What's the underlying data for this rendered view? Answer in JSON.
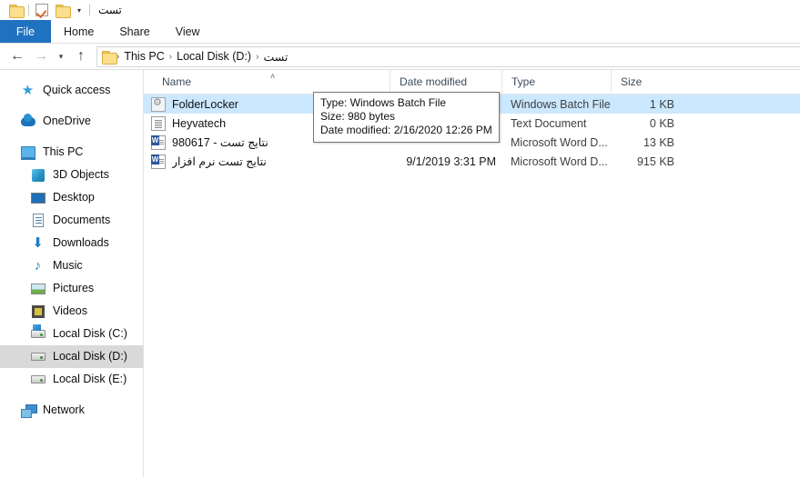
{
  "titlebar": {
    "quick_access": [
      {
        "name": "folder-icon",
        "label": ""
      },
      {
        "name": "properties-icon",
        "label": ""
      },
      {
        "name": "new-folder-icon",
        "label": ""
      }
    ],
    "dropdown_glyph": "▾",
    "window_title": "تست"
  },
  "ribbon": {
    "tabs": [
      {
        "label": "File",
        "active": true
      },
      {
        "label": "Home",
        "active": false
      },
      {
        "label": "Share",
        "active": false
      },
      {
        "label": "View",
        "active": false
      }
    ]
  },
  "navbar": {
    "back_glyph": "←",
    "forward_glyph": "→",
    "recent_glyph": "▾",
    "up_glyph": "↑",
    "separator": "›",
    "breadcrumbs": [
      {
        "label": "This PC",
        "rtl": false
      },
      {
        "label": "Local Disk (D:)",
        "rtl": false
      },
      {
        "label": "تست",
        "rtl": true
      }
    ]
  },
  "sidebar": {
    "items": [
      {
        "label": "Quick access",
        "icon": "star-icon",
        "indent": false,
        "selected": false,
        "gap_before": false
      },
      {
        "label": "OneDrive",
        "icon": "cloud-icon",
        "indent": false,
        "selected": false,
        "gap_before": true
      },
      {
        "label": "This PC",
        "icon": "this-pc-icon",
        "indent": false,
        "selected": false,
        "gap_before": true
      },
      {
        "label": "3D Objects",
        "icon": "cube-icon",
        "indent": true,
        "selected": false,
        "gap_before": false
      },
      {
        "label": "Desktop",
        "icon": "desktop-icon",
        "indent": true,
        "selected": false,
        "gap_before": false
      },
      {
        "label": "Documents",
        "icon": "documents-icon",
        "indent": true,
        "selected": false,
        "gap_before": false
      },
      {
        "label": "Downloads",
        "icon": "download-icon",
        "indent": true,
        "selected": false,
        "gap_before": false
      },
      {
        "label": "Music",
        "icon": "music-icon",
        "indent": true,
        "selected": false,
        "gap_before": false
      },
      {
        "label": "Pictures",
        "icon": "pictures-icon",
        "indent": true,
        "selected": false,
        "gap_before": false
      },
      {
        "label": "Videos",
        "icon": "videos-icon",
        "indent": true,
        "selected": false,
        "gap_before": false
      },
      {
        "label": "Local Disk (C:)",
        "icon": "windows-drive-icon",
        "indent": true,
        "selected": false,
        "gap_before": false
      },
      {
        "label": "Local Disk (D:)",
        "icon": "drive-icon",
        "indent": true,
        "selected": true,
        "gap_before": false
      },
      {
        "label": "Local Disk (E:)",
        "icon": "drive-icon",
        "indent": true,
        "selected": false,
        "gap_before": false
      },
      {
        "label": "Network",
        "icon": "network-icon",
        "indent": false,
        "selected": false,
        "gap_before": true
      }
    ]
  },
  "filelist": {
    "columns": [
      {
        "label": "Name",
        "sorted": true,
        "sort_glyph": "˄"
      },
      {
        "label": "Date modified",
        "sorted": false,
        "sort_glyph": ""
      },
      {
        "label": "Type",
        "sorted": false,
        "sort_glyph": ""
      },
      {
        "label": "Size",
        "sorted": false,
        "sort_glyph": ""
      }
    ],
    "rows": [
      {
        "name": "FolderLocker",
        "icon": "batch-file-icon",
        "rtl": false,
        "date_modified": "2/16/2020 12:26 PM",
        "type": "Windows Batch File",
        "size": "1 KB",
        "selected": true
      },
      {
        "name": "Heyvatech",
        "icon": "text-document-icon",
        "rtl": false,
        "date_modified": "",
        "type": "Text Document",
        "size": "0 KB",
        "selected": false
      },
      {
        "name": "نتایج تست - 980617",
        "icon": "word-document-icon",
        "rtl": true,
        "date_modified": "",
        "type": "Microsoft Word D...",
        "size": "13 KB",
        "selected": false
      },
      {
        "name": "نتایج تست نرم افزار",
        "icon": "word-document-icon",
        "rtl": true,
        "date_modified": "9/1/2019 3:31 PM",
        "type": "Microsoft Word D...",
        "size": "915 KB",
        "selected": false
      }
    ]
  },
  "tooltip": {
    "line1": "Type: Windows Batch File",
    "line2": "Size: 980 bytes",
    "line3": "Date modified: 2/16/2020 12:26 PM"
  },
  "colors": {
    "file_tab_blue": "#1f72c0",
    "selection_blue": "#cce8ff",
    "sidebar_selection_gray": "#d9d9d9",
    "folder_yellow": "#fbdf8d",
    "word_blue": "#2a5699"
  }
}
